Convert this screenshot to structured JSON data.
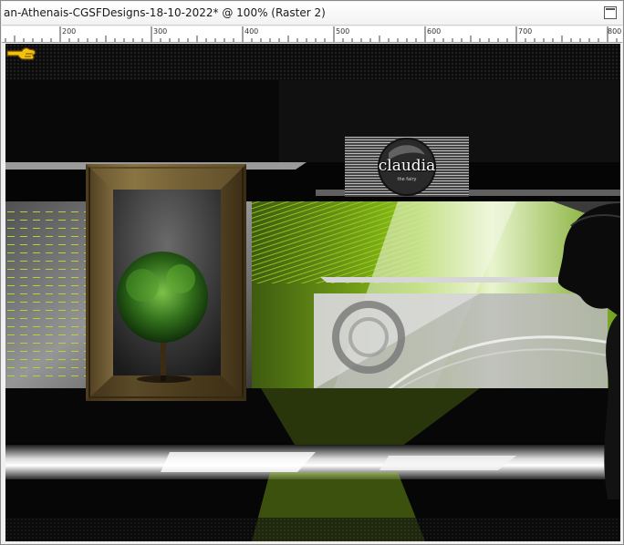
{
  "window": {
    "title": "an-Athenais-CGSFDesigns-18-10-2022* @ 100% (Raster 2)"
  },
  "ruler": {
    "labels": [
      "200",
      "300",
      "400",
      "500",
      "600",
      "700",
      "800"
    ]
  },
  "artwork": {
    "watermark_text": "claudia",
    "watermark_subtext": "the fairy",
    "accent_color": "#7fbf1a",
    "icons": [
      "pointing-hand-icon",
      "maximize-icon"
    ]
  }
}
